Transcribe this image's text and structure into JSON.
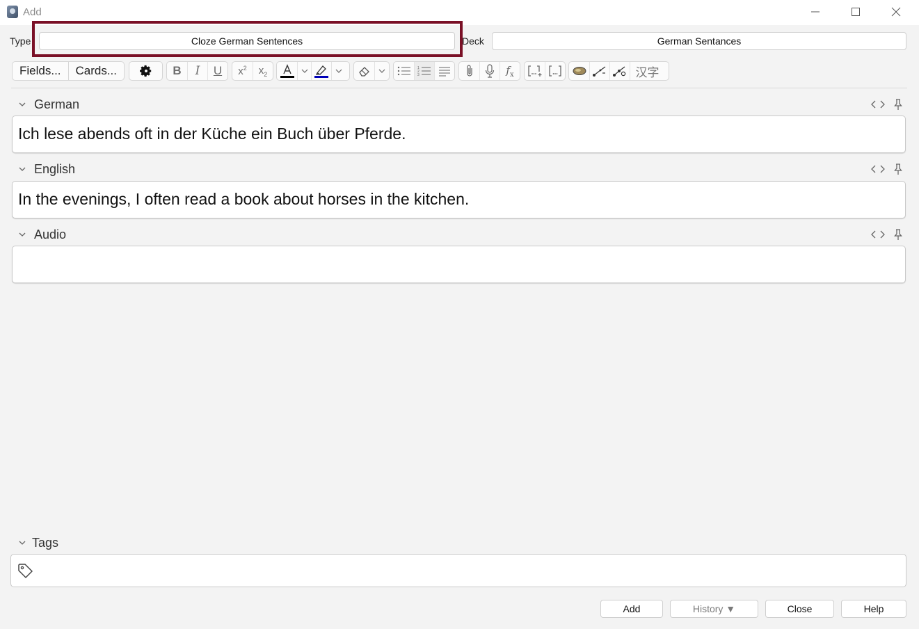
{
  "window": {
    "title": "Add"
  },
  "note_type": {
    "label": "Type",
    "value": "Cloze German Sentences"
  },
  "deck": {
    "label": "Deck",
    "value": "German Sentances"
  },
  "toolbar": {
    "fields_label": "Fields...",
    "cards_label": "Cards...",
    "cjk_label": "汉字",
    "text_color": "#000000",
    "highlight_color": "#0000b8"
  },
  "fields": [
    {
      "name": "German",
      "value": "Ich lese abends oft in der Küche ein Buch über Pferde."
    },
    {
      "name": "English",
      "value": "In the evenings, I often read a book about horses in the kitchen."
    },
    {
      "name": "Audio",
      "value": ""
    }
  ],
  "tags": {
    "label": "Tags",
    "value": ""
  },
  "buttons": {
    "add": "Add",
    "history": "History ▼",
    "close": "Close",
    "help": "Help"
  },
  "highlight_color": "#7a1026"
}
